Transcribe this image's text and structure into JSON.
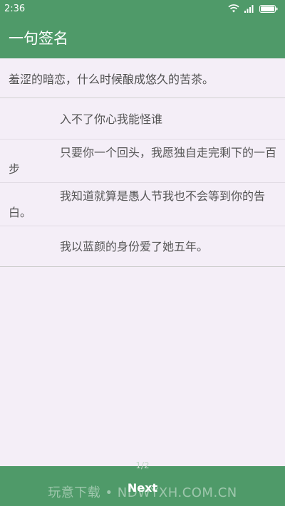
{
  "status_bar": {
    "time": "2:36",
    "icons": [
      "wifi-icon",
      "signal-icon",
      "battery-icon"
    ]
  },
  "app_bar": {
    "title": "一句签名"
  },
  "headline": "羞涩的暗恋，什么时候酿成悠久的苦茶。",
  "items": [
    "入不了你心我能怪谁",
    "只要你一个回头，我愿独自走完剩下的一百步",
    "我知道就算是愚人节我也不会等到你的告白。",
    "我以蓝颜的身份爱了她五年。"
  ],
  "pager": {
    "indicator": "1/2",
    "next_label": "Next"
  },
  "watermark": "玩意下载 • NDWYXH.COM.CN",
  "colors": {
    "primary": "#4f9a69",
    "background": "#f4eef7",
    "text": "#555555"
  }
}
